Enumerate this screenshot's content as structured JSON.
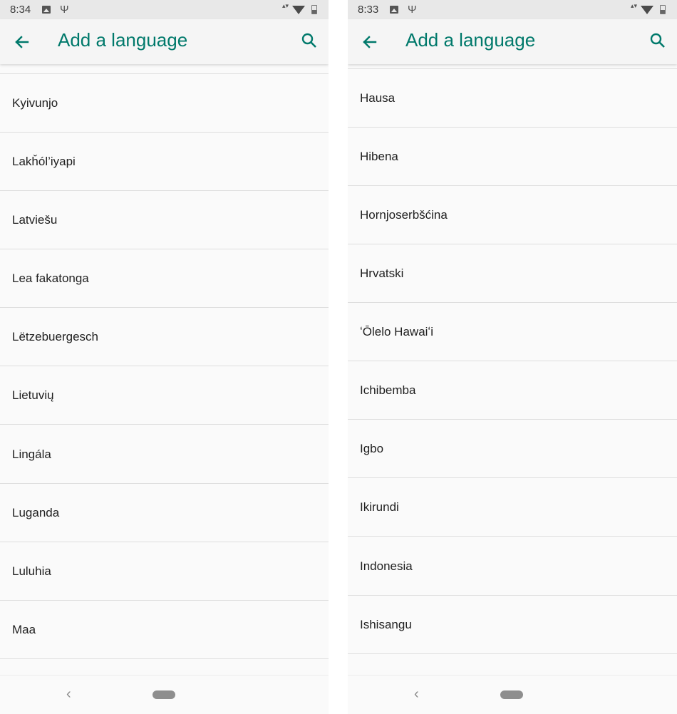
{
  "screens": [
    {
      "status_bar": {
        "time": "8:34"
      },
      "app_bar": {
        "title": "Add a language"
      },
      "languages": [
        "Kyivunjo",
        "Lakȟól’iyapi",
        "Latviešu",
        "Lea fakatonga",
        "Lëtzebuergesch",
        "Lietuvių",
        "Lingála",
        "Luganda",
        "Luluhia",
        "Maa"
      ]
    },
    {
      "status_bar": {
        "time": "8:33"
      },
      "app_bar": {
        "title": "Add a language"
      },
      "languages": [
        "Hausa",
        "Hibena",
        "Hornjoserbšćina",
        "Hrvatski",
        "ʻŌlelo Hawaiʻi",
        "Ichibemba",
        "Igbo",
        "Ikirundi",
        "Indonesia",
        "Ishisangu"
      ]
    }
  ],
  "icons": {
    "back": "arrow-back-icon",
    "search": "search-icon",
    "status_image": "image-icon",
    "status_usb": "usb-icon",
    "status_data": "data-arrows-icon",
    "status_wifi": "wifi-icon",
    "status_battery": "battery-icon",
    "nav_back": "chevron-left-icon",
    "nav_home": "home-pill-icon"
  },
  "colors": {
    "accent": "#00796b",
    "background": "#fafafa",
    "status_bar": "#e8e8e8",
    "divider": "#dedede",
    "text": "#1f1f1f"
  }
}
